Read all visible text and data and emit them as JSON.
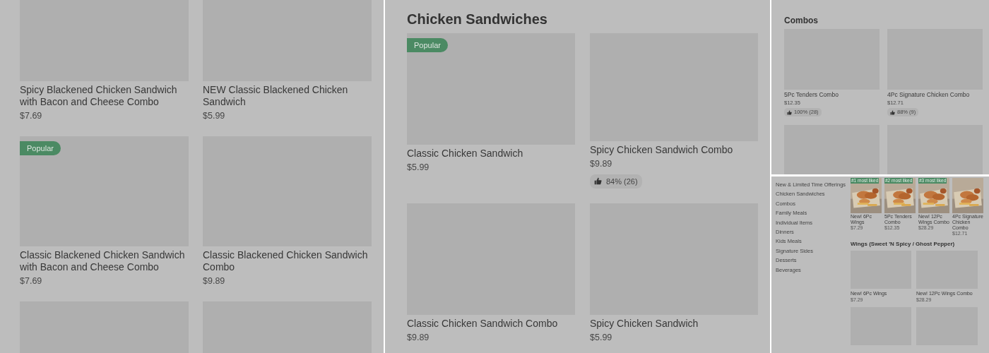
{
  "panels": [
    {
      "kind": "grid",
      "items": [
        {
          "kind": "item",
          "name": "Spicy Blackened Chicken Sandwich with Bacon and Cheese Combo",
          "price": "$7.69"
        },
        {
          "kind": "item",
          "name": "NEW Classic Blackened Chicken Sandwich",
          "price": "$5.99"
        },
        {
          "kind": "item",
          "name": "Classic Blackened Chicken Sandwich with Bacon and Cheese Combo",
          "price": "$7.69",
          "badge": "Popular"
        },
        {
          "kind": "item",
          "name": "Classic Blackened Chicken Sandwich Combo",
          "price": "$9.89"
        },
        {
          "kind": "image_only"
        },
        {
          "kind": "image_only"
        }
      ]
    },
    {
      "kind": "grid",
      "heading": "Chicken Sandwiches",
      "items": [
        {
          "kind": "item",
          "name": "Classic Chicken Sandwich",
          "price": "$5.99",
          "badge": "Popular"
        },
        {
          "kind": "item",
          "name": "Spicy Chicken Sandwich Combo",
          "price": "$9.89",
          "rating": "84% (26)"
        },
        {
          "kind": "item",
          "name": "Classic Chicken Sandwich Combo",
          "price": "$9.89"
        },
        {
          "kind": "item",
          "name": "Spicy Chicken Sandwich",
          "price": "$5.99"
        }
      ]
    },
    {
      "kind": "grid",
      "heading": "Combos",
      "items": [
        {
          "kind": "item",
          "name": "5Pc Tenders Combo",
          "price": "$12.35",
          "rating": "100% (28)"
        },
        {
          "kind": "item",
          "name": "4Pc Signature Chicken Combo",
          "price": "$12.71",
          "rating": "88% (9)"
        },
        {
          "kind": "image_only"
        },
        {
          "kind": "image_only"
        }
      ]
    },
    {
      "kind": "menu",
      "sidebar": {
        "items": [
          "New & Limited Time Offerings",
          "Chicken Sandwiches",
          "Combos",
          "Family Meals",
          "Individual Items",
          "Dinners",
          "Kids Meals",
          "Signature Sides",
          "Desserts",
          "Beverages"
        ]
      },
      "featured": [
        {
          "name": "New! 6Pc Wings",
          "price": "$7.29",
          "badge": "#1 most liked"
        },
        {
          "name": "5Pc Tenders Combo",
          "price": "$12.35",
          "badge": "#2 most liked"
        },
        {
          "name": "New! 12Pc Wings Combo",
          "price": "$28.29",
          "badge": "#3 most liked"
        },
        {
          "name": "4Pc Signature Chicken Combo",
          "price": "$12.71"
        }
      ],
      "section": {
        "heading": "Wings (Sweet 'N Spicy / Ghost Pepper)",
        "items": [
          {
            "kind": "item",
            "name": "New! 6Pc Wings",
            "price": "$7.29"
          },
          {
            "kind": "item",
            "name": "New! 12Pc Wings Combo",
            "price": "$28.29"
          },
          {
            "kind": "image_only"
          },
          {
            "kind": "image_only"
          }
        ]
      }
    }
  ]
}
